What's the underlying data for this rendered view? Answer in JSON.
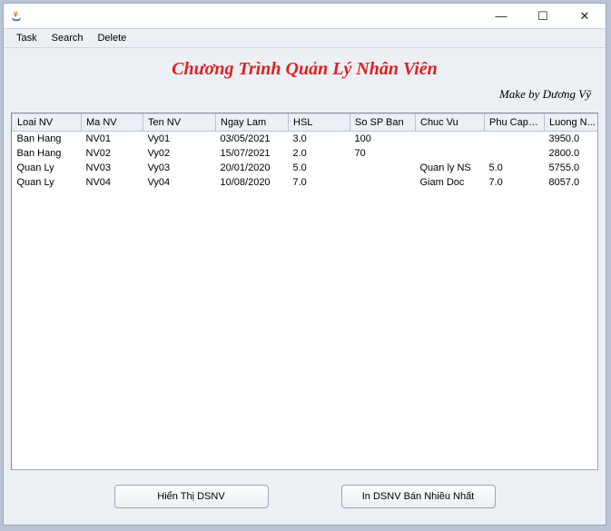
{
  "window": {
    "title": ""
  },
  "menu": {
    "items": [
      "Task",
      "Search",
      "Delete"
    ]
  },
  "header": {
    "title": "Chương Trình Quản Lý Nhân Viên",
    "credit": "Make by Dương Vỹ"
  },
  "table": {
    "columns": [
      "Loai NV",
      "Ma NV",
      "Ten NV",
      "Ngay Lam",
      "HSL",
      "So SP Ban",
      "Chuc Vu",
      "Phu Cap ...",
      "Luong N..."
    ],
    "rows": [
      [
        "Ban Hang",
        "NV01",
        "Vy01",
        "03/05/2021",
        "3.0",
        "100",
        "",
        "",
        "3950.0"
      ],
      [
        "Ban Hang",
        "NV02",
        "Vy02",
        "15/07/2021",
        "2.0",
        "70",
        "",
        "",
        "2800.0"
      ],
      [
        "Quan Ly",
        "NV03",
        "Vy03",
        "20/01/2020",
        "5.0",
        "",
        "Quan ly NS",
        "5.0",
        "5755.0"
      ],
      [
        "Quan Ly",
        "NV04",
        "Vy04",
        "10/08/2020",
        "7.0",
        "",
        "Giam Doc",
        "7.0",
        "8057.0"
      ]
    ]
  },
  "buttons": {
    "show": "Hiển Thị DSNV",
    "print": "In DSNV Bán Nhiều Nhất"
  },
  "win_controls": {
    "min": "—",
    "max": "☐",
    "close": "✕"
  }
}
